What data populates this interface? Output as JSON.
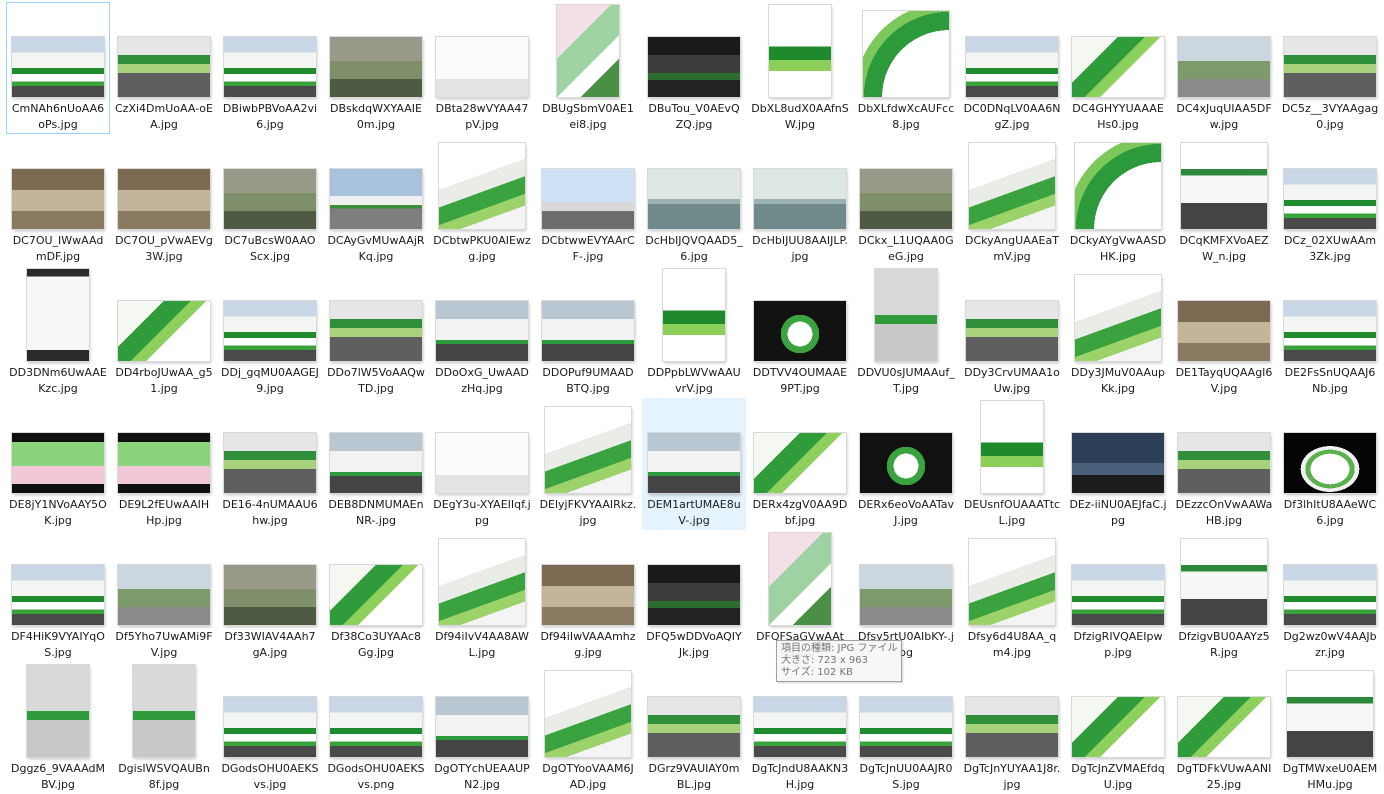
{
  "tooltip": {
    "type_line": "項目の種類: JPG ファイル",
    "size_line": "大きさ: 723 x 963",
    "file_size_line": "サイズ: 102 KB"
  },
  "files": [
    {
      "name": "CmNAh6nUoAA6oPs.jpg",
      "kind": "bus",
      "selected": true
    },
    {
      "name": "CzXi4DmUoAA-oEA.jpg",
      "kind": "window"
    },
    {
      "name": "DBiwbPBVoAA2vi6.jpg",
      "kind": "bus"
    },
    {
      "name": "DBskdqWXYAAIE0m.jpg",
      "kind": "photo"
    },
    {
      "name": "DBta28wVYAA47pV.jpg",
      "kind": "white"
    },
    {
      "name": "DBUgSbmV0AE1ei8.jpg",
      "kind": "anime"
    },
    {
      "name": "DBuTou_V0AEvQZQ.jpg",
      "kind": "dark"
    },
    {
      "name": "DbXL8udX0AAfnSW.jpg",
      "kind": "stripe"
    },
    {
      "name": "DbXLfdwXcAUFcc8.jpg",
      "kind": "arc"
    },
    {
      "name": "DC0DNqLV0AA6NgZ.jpg",
      "kind": "bus"
    },
    {
      "name": "DC4GHYYUAAAEHs0.jpg",
      "kind": "green"
    },
    {
      "name": "DC4xJuqUIAA5DFw.jpg",
      "kind": "road"
    },
    {
      "name": "DC5z__3VYAAgag0.jpg",
      "kind": "window"
    },
    {
      "name": "DC7OU_IWwAAdmDF.jpg",
      "kind": "indoor"
    },
    {
      "name": "DC7OU_pVwAEVg3W.jpg",
      "kind": "indoor"
    },
    {
      "name": "DC7uBcsW0AAOScx.jpg",
      "kind": "photo"
    },
    {
      "name": "DCAyGvMUwAAjRKq.jpg",
      "kind": "plane"
    },
    {
      "name": "DCbtwPKU0AIEwzg.jpg",
      "kind": "box"
    },
    {
      "name": "DCbtwwEVYAArCF-.jpg",
      "kind": "sky"
    },
    {
      "name": "DcHbIJQVQAAD5_6.jpg",
      "kind": "sea"
    },
    {
      "name": "DcHbIJUU8AAIJLP.jpg",
      "kind": "sea"
    },
    {
      "name": "DCkx_L1UQAA0GeG.jpg",
      "kind": "photo"
    },
    {
      "name": "DCkyAngUAAEaTmV.jpg",
      "kind": "box"
    },
    {
      "name": "DCkyAYgVwAASDHK.jpg",
      "kind": "arc"
    },
    {
      "name": "DCqKMFXVoAEZW_n.jpg",
      "kind": "sign"
    },
    {
      "name": "DCz_02XUwAAm3Zk.jpg",
      "kind": "bus"
    },
    {
      "name": "DD3DNm6UwAAEKzc.jpg",
      "kind": "phone"
    },
    {
      "name": "DD4rboJUwAA_g51.jpg",
      "kind": "green"
    },
    {
      "name": "DDj_gqMU0AAGEJ9.jpg",
      "kind": "bus"
    },
    {
      "name": "DDo7lW5VoAAQwTD.jpg",
      "kind": "window"
    },
    {
      "name": "DDoOxG_UwAADzHq.jpg",
      "kind": "truck"
    },
    {
      "name": "DDOPuf9UMAADBTQ.jpg",
      "kind": "truck"
    },
    {
      "name": "DDPpbLWVwAAUvrV.jpg",
      "kind": "stripe"
    },
    {
      "name": "DDTVV4OUMAAE9PT.jpg",
      "kind": "box-dark"
    },
    {
      "name": "DDVU0sJUMAAuf_T.jpg",
      "kind": "person"
    },
    {
      "name": "DDy3CrvUMAA1oUw.jpg",
      "kind": "window"
    },
    {
      "name": "DDy3JMuV0AAupKk.jpg",
      "kind": "box"
    },
    {
      "name": "DE1TayqUQAAgI6V.jpg",
      "kind": "indoor"
    },
    {
      "name": "DE2FsSnUQAAJ6Nb.jpg",
      "kind": "bus"
    },
    {
      "name": "DE8jY1NVoAAY5OK.jpg",
      "kind": "screen"
    },
    {
      "name": "DE9L2fEUwAAIHHp.jpg",
      "kind": "screen"
    },
    {
      "name": "DE16-4nUMAAU6hw.jpg",
      "kind": "window"
    },
    {
      "name": "DEB8DNMUMAEnNR-.jpg",
      "kind": "truck"
    },
    {
      "name": "DEgY3u-XYAEIIqf.jpg",
      "kind": "white"
    },
    {
      "name": "DElyjFKVYAAIRkz.jpg",
      "kind": "box"
    },
    {
      "name": "DEM1artUMAE8uV-.jpg",
      "kind": "truck",
      "hovered": true
    },
    {
      "name": "DERx4zgV0AA9Dbf.jpg",
      "kind": "green"
    },
    {
      "name": "DERx6eoVoAATavJ.jpg",
      "kind": "box-dark"
    },
    {
      "name": "DEUsnfOUAAATtcL.jpg",
      "kind": "stripe"
    },
    {
      "name": "DEz-iiNU0AEJfaC.jpg",
      "kind": "night"
    },
    {
      "name": "DEzzcOnVwAAWaHB.jpg",
      "kind": "window"
    },
    {
      "name": "Df3lhItU8AAeWC6.jpg",
      "kind": "shoe"
    },
    {
      "name": "DF4HiK9VYAIYqOS.jpg",
      "kind": "bus"
    },
    {
      "name": "Df5Yho7UwAMi9FV.jpg",
      "kind": "road"
    },
    {
      "name": "Df33WIAV4AAh7gA.jpg",
      "kind": "photo"
    },
    {
      "name": "Df38Co3UYAAc8Gg.jpg",
      "kind": "green"
    },
    {
      "name": "Df94iIvV4AA8AWL.jpg",
      "kind": "box"
    },
    {
      "name": "Df94iIwVAAAmhzg.jpg",
      "kind": "indoor"
    },
    {
      "name": "DFQ5wDDVoAQIYJk.jpg",
      "kind": "dark"
    },
    {
      "name": "DFQFSaGVwAAt G.jpg",
      "kind": "anime"
    },
    {
      "name": "Dfsy5rtU0AIbKY-.jpg",
      "kind": "road"
    },
    {
      "name": "Dfsy6d4U8AA_qm4.jpg",
      "kind": "box"
    },
    {
      "name": "DfzigRIVQAEIpwp.jpg",
      "kind": "bus"
    },
    {
      "name": "DfzigvBU0AAYz5R.jpg",
      "kind": "sign"
    },
    {
      "name": "Dg2wz0wV4AAJbzr.jpg",
      "kind": "bus"
    },
    {
      "name": "Dggz6_9VAAAdMBV.jpg",
      "kind": "person"
    },
    {
      "name": "DgisIWSVQAUBn8f.jpg",
      "kind": "person"
    },
    {
      "name": "DGodsOHU0AEKSvs.jpg",
      "kind": "bus"
    },
    {
      "name": "DGodsOHU0AEKSvs.png",
      "kind": "bus"
    },
    {
      "name": "DgOTYchUEAAUPN2.jpg",
      "kind": "truck"
    },
    {
      "name": "DgOTYooVAAM6JAD.jpg",
      "kind": "box"
    },
    {
      "name": "DGrz9VAUIAY0mBL.jpg",
      "kind": "window"
    },
    {
      "name": "DgTcJndU8AAKN3H.jpg",
      "kind": "bus"
    },
    {
      "name": "DgTcJnUU0AAJR0S.jpg",
      "kind": "bus"
    },
    {
      "name": "DgTcJnYUYAA1J8r.jpg",
      "kind": "window"
    },
    {
      "name": "DgTcJnZVMAEfdqU.jpg",
      "kind": "green"
    },
    {
      "name": "DgTDFkVUwAANI25.jpg",
      "kind": "green"
    },
    {
      "name": "DgTMWxeU0AEMHMu.jpg",
      "kind": "sign"
    }
  ]
}
